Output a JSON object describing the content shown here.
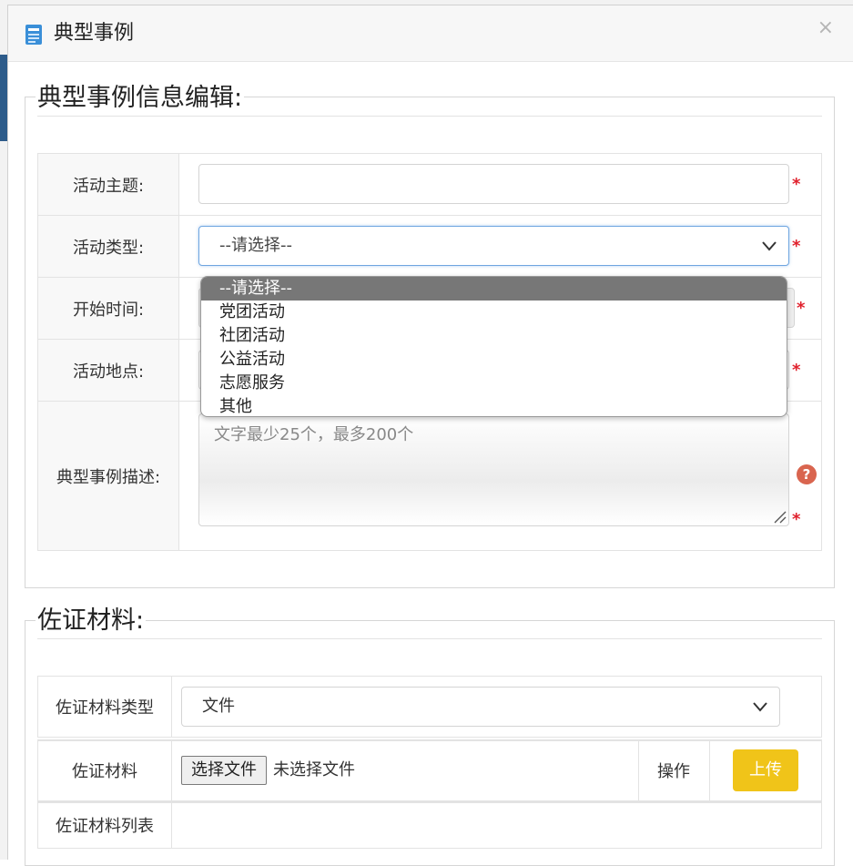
{
  "modal": {
    "title": "典型事例",
    "close_label": "×"
  },
  "section_info": {
    "legend": "典型事例信息编辑:",
    "fields": {
      "topic_label": "活动主题:",
      "topic_value": "",
      "type_label": "活动类型:",
      "type_value": "--请选择--",
      "start_label": "开始时间:",
      "place_label": "活动地点:",
      "desc_label": "典型事例描述:",
      "desc_placeholder": "文字最少25个，最多200个"
    },
    "required_mark": "*",
    "help_mark": "?",
    "type_options": [
      "--请选择--",
      "党团活动",
      "社团活动",
      "公益活动",
      "志愿服务",
      "其他"
    ],
    "type_options_selected_index": 0
  },
  "section_evidence": {
    "legend": "佐证材料:",
    "type_label": "佐证材料类型",
    "type_value": "文件",
    "material_label": "佐证材料",
    "choose_file_label": "选择文件",
    "no_file_text": "未选择文件",
    "action_label": "操作",
    "upload_label": "上传",
    "list_label": "佐证材料列表"
  },
  "colors": {
    "accent_blue": "#6fa6e0",
    "required_red": "#e0202c",
    "upload_yellow": "#f0c419",
    "help_red": "#d9654f"
  }
}
